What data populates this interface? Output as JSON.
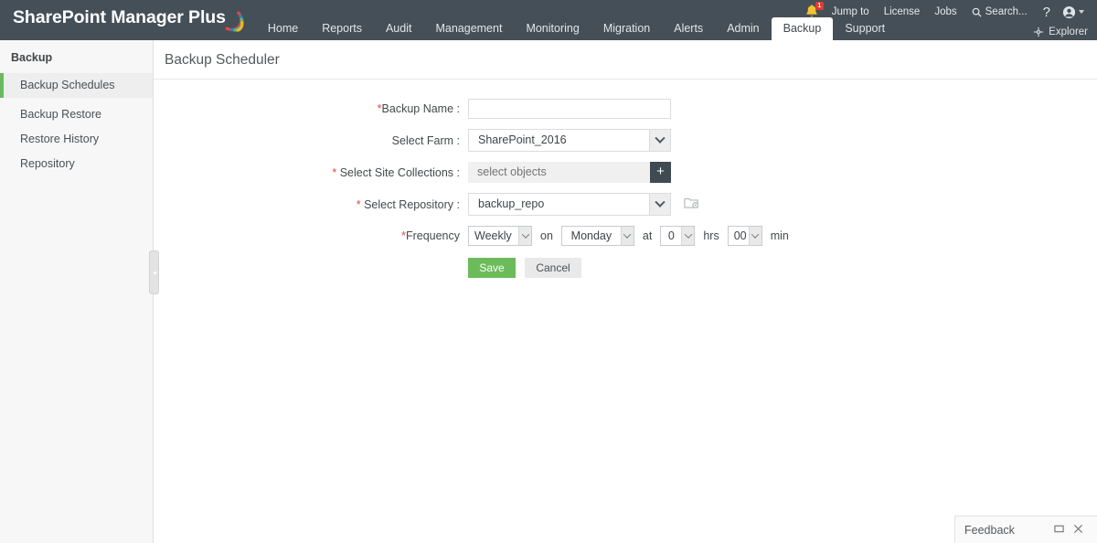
{
  "header": {
    "brand": "SharePoint Manager Plus",
    "nav": [
      {
        "label": "Home",
        "active": false
      },
      {
        "label": "Reports",
        "active": false
      },
      {
        "label": "Audit",
        "active": false
      },
      {
        "label": "Management",
        "active": false
      },
      {
        "label": "Monitoring",
        "active": false
      },
      {
        "label": "Migration",
        "active": false
      },
      {
        "label": "Alerts",
        "active": false
      },
      {
        "label": "Admin",
        "active": false
      },
      {
        "label": "Backup",
        "active": true
      },
      {
        "label": "Support",
        "active": false
      }
    ],
    "notification_count": "1",
    "jump_to": "Jump to",
    "license": "License",
    "jobs": "Jobs",
    "search": "Search...",
    "help": "?",
    "explorer": "Explorer",
    "bg_color": "#454f57",
    "active_tab_color": "#ffffff"
  },
  "sidebar": {
    "title": "Backup",
    "items": [
      {
        "label": "Backup Schedules",
        "active": true
      },
      {
        "label": "Backup Restore",
        "active": false
      },
      {
        "label": "Restore History",
        "active": false
      },
      {
        "label": "Repository",
        "active": false
      }
    ],
    "accent_color": "#67bb5e"
  },
  "page": {
    "title": "Backup Scheduler"
  },
  "form": {
    "backup_name": {
      "label": "Backup Name :",
      "required": true,
      "value": "",
      "placeholder": ""
    },
    "select_farm": {
      "label": "Select Farm :",
      "required": false,
      "value": "SharePoint_2016"
    },
    "select_site_collections": {
      "label": "Select Site Collections :",
      "required": true,
      "value": "",
      "placeholder": "select objects",
      "add_button": "+"
    },
    "select_repository": {
      "label": "Select Repository :",
      "required": true,
      "value": "backup_repo"
    },
    "frequency": {
      "label": "Frequency",
      "required": true,
      "value": "Weekly",
      "on_text": "on",
      "day": "Monday",
      "at_text": "at",
      "hours": "0",
      "hours_text": "hrs",
      "minutes": "00",
      "minutes_text": "min"
    },
    "save_label": "Save",
    "cancel_label": "Cancel",
    "save_color": "#6cbb5a",
    "required_color": "#e8453c"
  },
  "feedback": {
    "label": "Feedback"
  }
}
